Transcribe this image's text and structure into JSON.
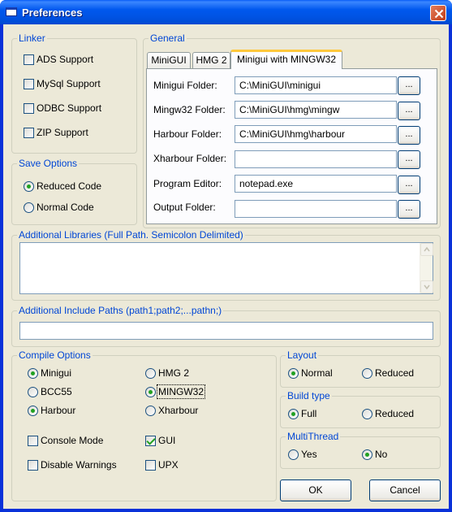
{
  "window": {
    "title": "Preferences"
  },
  "linker": {
    "title": "Linker",
    "items": [
      {
        "label": "ADS Support",
        "checked": false
      },
      {
        "label": "MySql Support",
        "checked": false
      },
      {
        "label": "ODBC Support",
        "checked": false
      },
      {
        "label": "ZIP Support",
        "checked": false
      }
    ]
  },
  "save_options": {
    "title": "Save Options",
    "items": [
      {
        "label": "Reduced Code",
        "selected": true
      },
      {
        "label": "Normal Code",
        "selected": false
      }
    ]
  },
  "general": {
    "title": "General",
    "tabs": [
      "MiniGUI",
      "HMG 2",
      "Minigui with MINGW32"
    ],
    "active_tab": 2,
    "browse_label": "...",
    "fields": [
      {
        "label": "Minigui Folder:",
        "value": "C:\\MiniGUI\\minigui"
      },
      {
        "label": "Mingw32 Folder:",
        "value": "C:\\MiniGUI\\hmg\\mingw"
      },
      {
        "label": "Harbour Folder:",
        "value": "C:\\MiniGUI\\hmg\\harbour"
      },
      {
        "label": "Xharbour Folder:",
        "value": ""
      },
      {
        "label": "Program Editor:",
        "value": "notepad.exe"
      },
      {
        "label": "Output Folder:",
        "value": ""
      }
    ]
  },
  "additional_libraries": {
    "title": "Additional Libraries (Full Path. Semicolon Delimited)",
    "value": ""
  },
  "additional_include": {
    "title": "Additional Include Paths (path1;path2;...pathn;)",
    "value": ""
  },
  "compile_options": {
    "title": "Compile Options",
    "radios": [
      {
        "label": "Minigui",
        "selected": true
      },
      {
        "label": "HMG 2",
        "selected": false
      },
      {
        "label": "BCC55",
        "selected": false
      },
      {
        "label": "MINGW32",
        "selected": true
      },
      {
        "label": "Harbour",
        "selected": true
      },
      {
        "label": "Xharbour",
        "selected": false
      }
    ],
    "checks": [
      {
        "label": "Console Mode",
        "checked": false
      },
      {
        "label": "GUI",
        "checked": true
      },
      {
        "label": "Disable Warnings",
        "checked": false
      },
      {
        "label": "UPX",
        "checked": false
      }
    ]
  },
  "layout": {
    "title": "Layout",
    "options": [
      {
        "label": "Normal",
        "selected": true
      },
      {
        "label": "Reduced",
        "selected": false
      }
    ]
  },
  "build_type": {
    "title": "Build type",
    "options": [
      {
        "label": "Full",
        "selected": true
      },
      {
        "label": "Reduced",
        "selected": false
      }
    ]
  },
  "multithread": {
    "title": "MultiThread",
    "options": [
      {
        "label": "Yes",
        "selected": false
      },
      {
        "label": "No",
        "selected": true
      }
    ]
  },
  "buttons": {
    "ok": "OK",
    "cancel": "Cancel"
  },
  "colors": {
    "titlebar": "#0054e3",
    "group_title": "#0046d5",
    "dialog_bg": "#ece9d8",
    "check_mark": "#21a121"
  }
}
